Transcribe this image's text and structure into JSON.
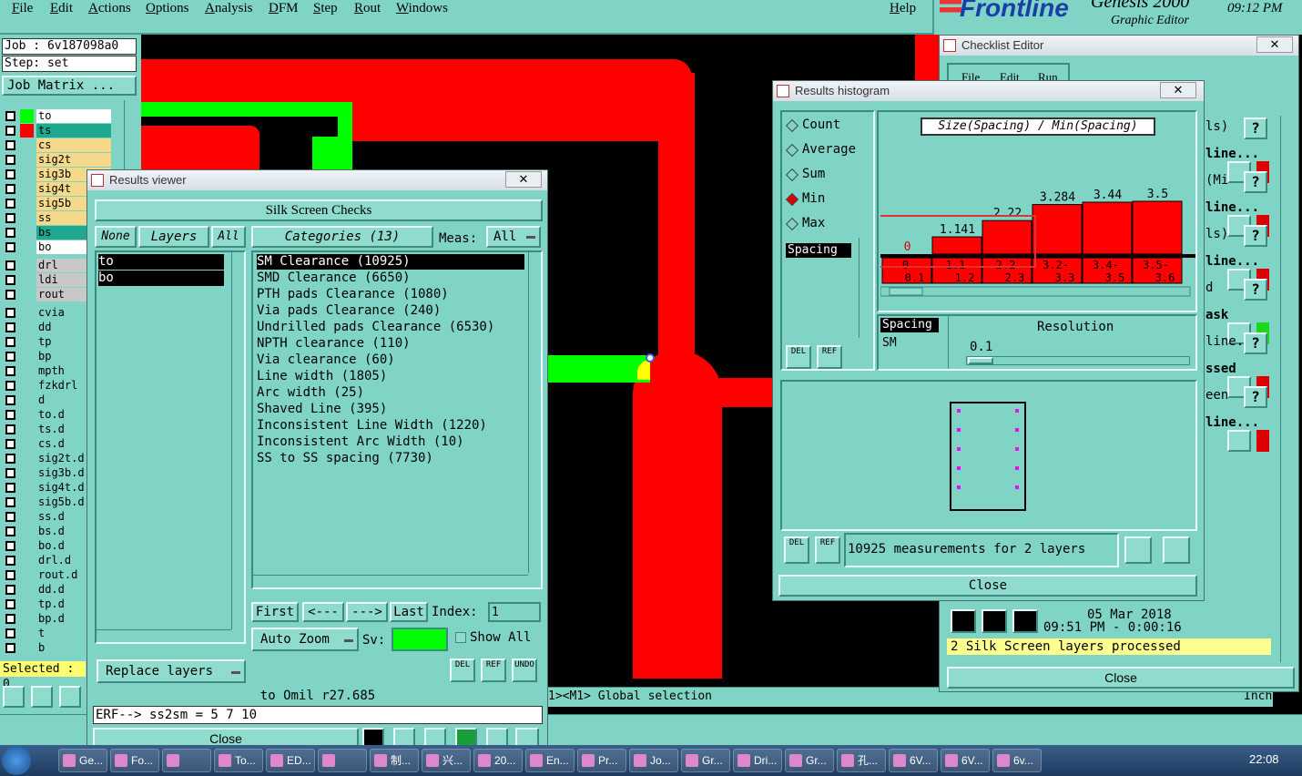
{
  "menu": [
    "File",
    "Edit",
    "Actions",
    "Options",
    "Analysis",
    "DFM",
    "Step",
    "Rout",
    "Windows"
  ],
  "help": "Help",
  "brand": {
    "name": "Frontline",
    "product": "Genesis 2000",
    "subtitle": "Graphic Editor",
    "time": "09:12 PM"
  },
  "left": {
    "job": "Job : 6v187098a0",
    "step": "Step: set",
    "job_matrix": "Job Matrix ...",
    "layers_group1": [
      {
        "name": "to",
        "color": "#00ff00",
        "cls": "white"
      },
      {
        "name": "ts",
        "color": "#ff0000",
        "cls": "teal"
      },
      {
        "name": "cs",
        "color": "",
        "cls": "tan"
      },
      {
        "name": "sig2t",
        "color": "",
        "cls": "tan"
      },
      {
        "name": "sig3b",
        "color": "",
        "cls": "tan"
      },
      {
        "name": "sig4t",
        "color": "",
        "cls": "tan"
      },
      {
        "name": "sig5b",
        "color": "",
        "cls": "tan"
      },
      {
        "name": "ss",
        "color": "",
        "cls": "tan"
      },
      {
        "name": "bs",
        "color": "",
        "cls": "teal"
      },
      {
        "name": "bo",
        "color": "",
        "cls": "white"
      }
    ],
    "layers_group2": [
      "drl",
      "ldi",
      "rout"
    ],
    "layers_group3": [
      "cvia",
      "dd",
      "tp",
      "bp",
      "mpth",
      "fzkdrl",
      "d",
      "to.d",
      "ts.d",
      "cs.d",
      "sig2t.d",
      "sig3b.d",
      "sig4t.d",
      "sig5b.d",
      "ss.d",
      "bs.d",
      "bo.d",
      "drl.d",
      "rout.d",
      "dd.d",
      "tp.d",
      "bp.d",
      "t",
      "b"
    ],
    "selected": "Selected : 0"
  },
  "results_viewer": {
    "title": "Results viewer",
    "header": "Silk Screen Checks",
    "none": "None",
    "layers": "Layers",
    "all": "All",
    "categories": "Categories (13)",
    "meas_label": "Meas:",
    "meas_value": "All",
    "layer_list": [
      "to",
      "bo"
    ],
    "category_list": [
      "SM Clearance (10925)",
      "SMD Clearance (6650)",
      "PTH pads Clearance (1080)",
      "Via pads Clearance (240)",
      "Undrilled pads Clearance (6530)",
      "NPTH clearance (110)",
      "Via clearance (60)",
      "Line width (1805)",
      "Arc width (25)",
      "Shaved Line (395)",
      "Inconsistent Line Width (1220)",
      "Inconsistent Arc Width (10)",
      "SS to SS spacing (7730)"
    ],
    "first": "First",
    "prev": "<---",
    "next": "--->",
    "last": "Last",
    "index_label": "Index:",
    "index_value": "1",
    "auto_zoom": "Auto Zoom",
    "sv": "Sv:",
    "show_all": "Show All",
    "replace_layers": "Replace layers",
    "del": "DEL",
    "ref": "REF",
    "undo": "UNDO",
    "status1": "to Omil  r27.685",
    "status2": "ERF--> ss2sm = 5 7 10",
    "close": "Close"
  },
  "histogram": {
    "title": "Results histogram",
    "modes": [
      "Count",
      "Average",
      "Sum",
      "Min",
      "Max"
    ],
    "selected_mode": "Min",
    "chart_title": "Size(Spacing) / Min(Spacing)",
    "list_label": "Spacing",
    "spacing_sel": "Spacing",
    "spacing_sm": "SM",
    "resolution_label": "Resolution",
    "resolution_value": "0.1",
    "measurements": "10925 measurements for 2 layers",
    "close": "Close",
    "del": "DEL",
    "ref": "REF"
  },
  "chart_data": {
    "type": "bar",
    "title": "Size(Spacing) / Min(Spacing)",
    "categories": [
      "0-0.1",
      "1.1-1.2",
      "2.2-2.3",
      "3.2-3.3",
      "3.4-3.5",
      "3.5-3.6"
    ],
    "values": [
      0,
      1.141,
      2.22,
      3.284,
      3.44,
      3.5
    ],
    "labels": [
      "0",
      "1.141",
      "2.22",
      "3.284",
      "3.44",
      "3.5"
    ],
    "cat_top": [
      "0",
      "1.1",
      "2.2",
      "3.2-",
      "3.4-",
      "3.5-"
    ],
    "cat_bot": [
      "0.1",
      "1.2",
      "2.3",
      "3.3",
      "3.5",
      "3.6"
    ],
    "ylim": [
      0,
      3.5
    ],
    "bar_color": "#ff0000"
  },
  "checklist": {
    "title": "Checklist Editor",
    "menu": [
      "File",
      "Edit",
      "Run"
    ],
    "rows": [
      "ls)",
      "line...",
      "(Mi",
      "line...",
      "ls)",
      "line...",
      "d",
      "ask",
      "line...",
      "ssed",
      "een",
      "line..."
    ],
    "date": "05 Mar 2018",
    "time": "09:51 PM - 0:00:16",
    "status": "2 Silk Screen layers processed",
    "close": "Close"
  },
  "canvas_status": "1><M1> Global selection",
  "inch": "Inch",
  "taskbar": {
    "items": [
      "Ge...",
      "Fo...",
      "",
      "To...",
      "ED...",
      "",
      "制...",
      "兴...",
      "20...",
      "En...",
      "Pr...",
      "Jo...",
      "Gr...",
      "Dri...",
      "Gr...",
      "孔...",
      "6V...",
      "6V...",
      "6v..."
    ],
    "clock": "22:08"
  }
}
